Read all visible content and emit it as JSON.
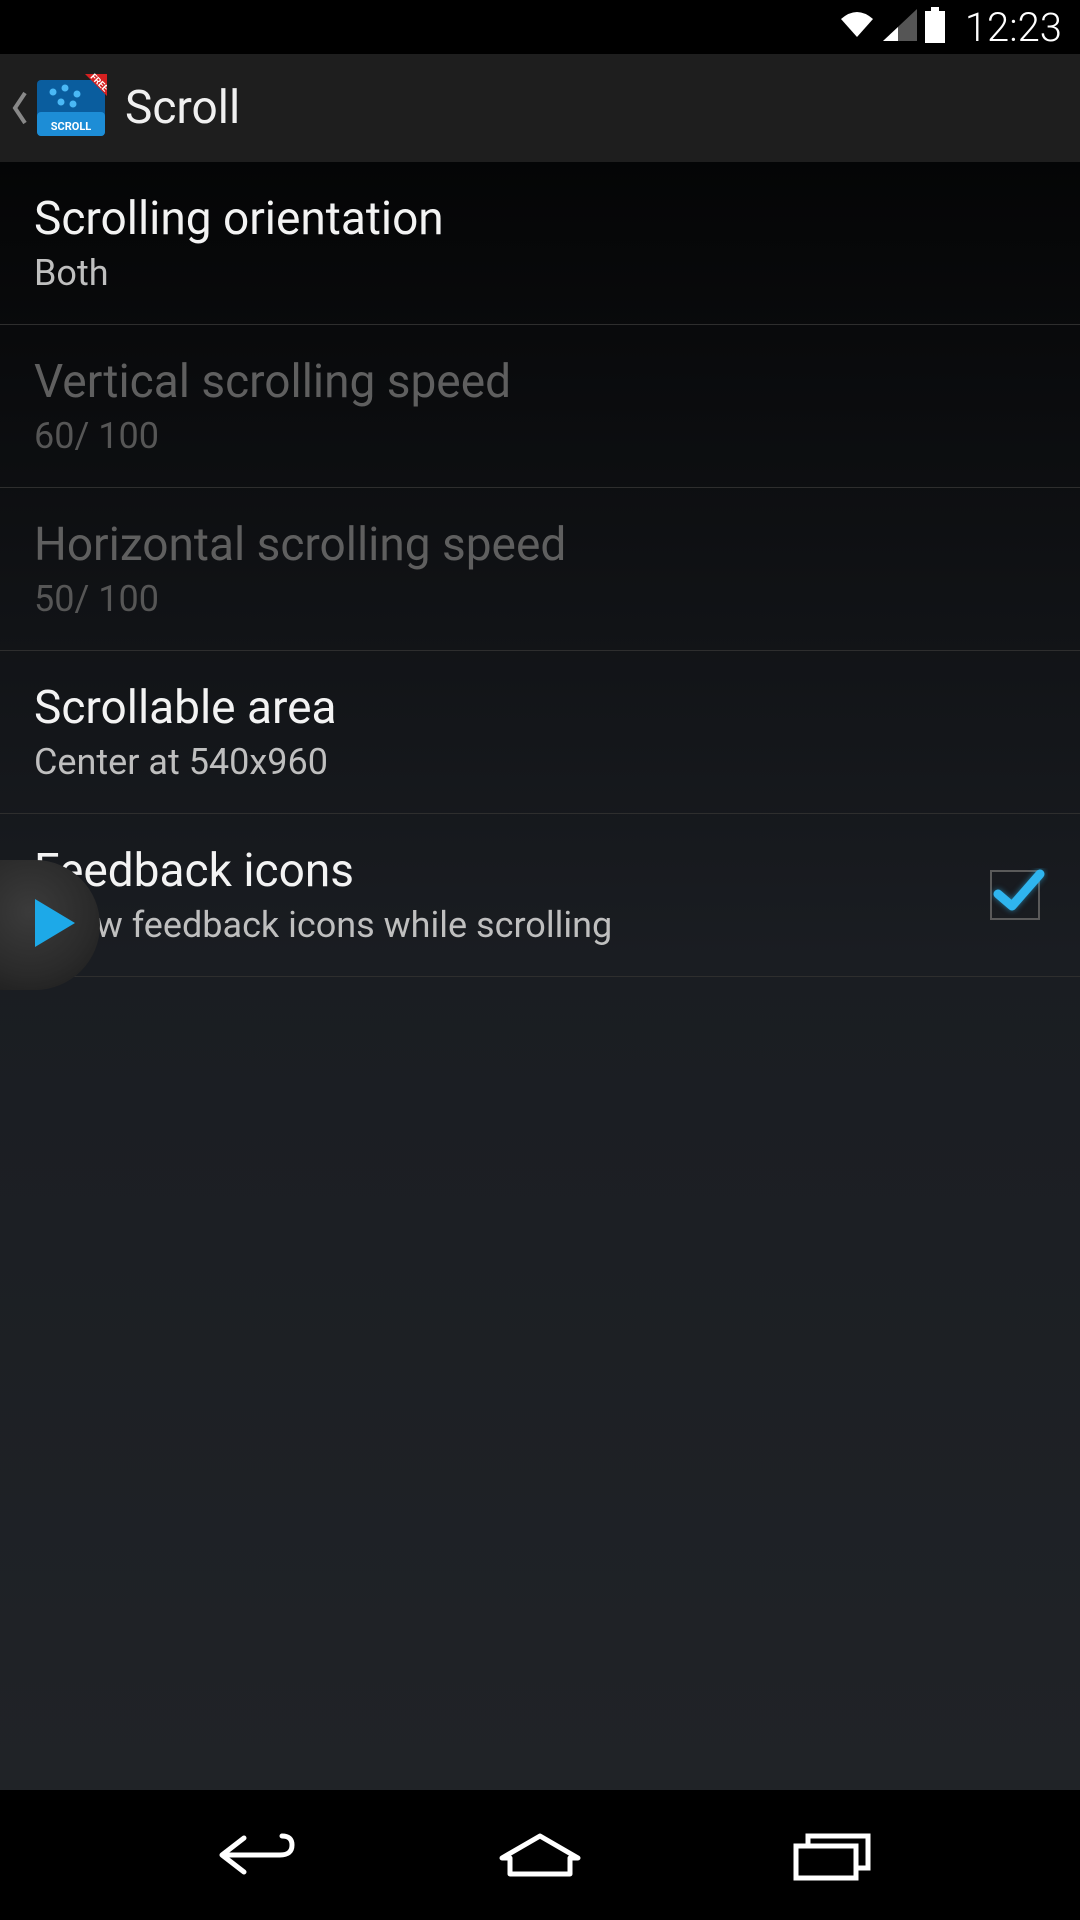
{
  "status_bar": {
    "time": "12:23"
  },
  "action_bar": {
    "title": "Scroll"
  },
  "settings": {
    "orientation": {
      "title": "Scrolling orientation",
      "value": "Both"
    },
    "vertical_speed": {
      "title": "Vertical scrolling speed",
      "value": "60/ 100"
    },
    "horizontal_speed": {
      "title": "Horizontal scrolling speed",
      "value": "50/ 100"
    },
    "scrollable_area": {
      "title": "Scrollable area",
      "value": "Center at 540x960"
    },
    "feedback_icons": {
      "title": "Feedback icons",
      "subtitle": "Show feedback icons while scrolling",
      "checked": true
    }
  },
  "colors": {
    "accent": "#1da9e8"
  }
}
